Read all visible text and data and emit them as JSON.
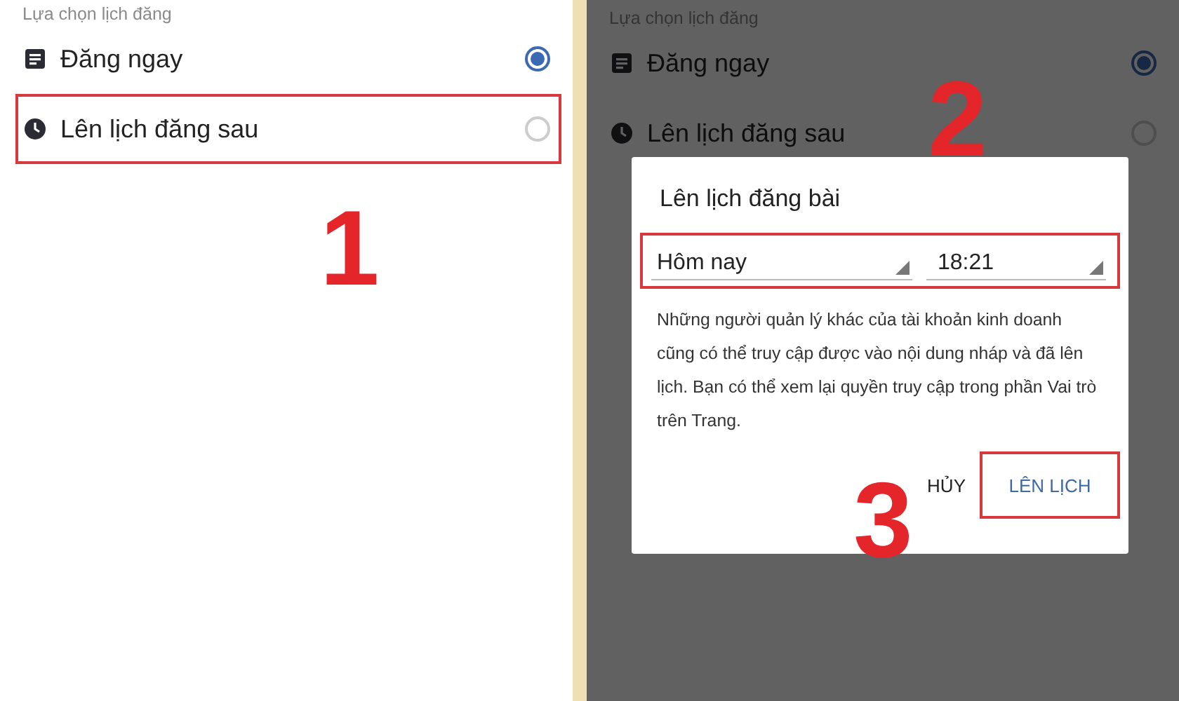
{
  "panels": [
    {
      "section_label": "Lựa chọn lịch đăng",
      "dimmed": false,
      "step": "1",
      "options": [
        {
          "label": "Đăng ngay",
          "kind": "post",
          "selected": true,
          "highlighted": false
        },
        {
          "label": "Lên lịch đăng sau",
          "kind": "clock",
          "selected": false,
          "highlighted": true
        }
      ]
    },
    {
      "section_label": "Lựa chọn lịch đăng",
      "dimmed": true,
      "step": "2",
      "options": [
        {
          "label": "Đăng ngay",
          "kind": "post",
          "selected": true,
          "highlighted": false
        },
        {
          "label": "Lên lịch đăng sau",
          "kind": "clock",
          "selected": false,
          "highlighted": false
        }
      ],
      "dialog": {
        "title": "Lên lịch đăng bài",
        "date": "Hôm nay",
        "time": "18:21",
        "fields_highlighted": true,
        "message": "Những người quản lý khác của tài khoản kinh doanh cũng có thể truy cập được vào nội dung nháp và đã lên lịch. Bạn có thể xem lại quyền truy cập trong phần Vai trò trên Trang.",
        "step": "3",
        "buttons": [
          {
            "label": "HỦY",
            "highlighted": false
          },
          {
            "label": "LÊN LỊCH",
            "highlighted": true
          }
        ]
      }
    }
  ]
}
